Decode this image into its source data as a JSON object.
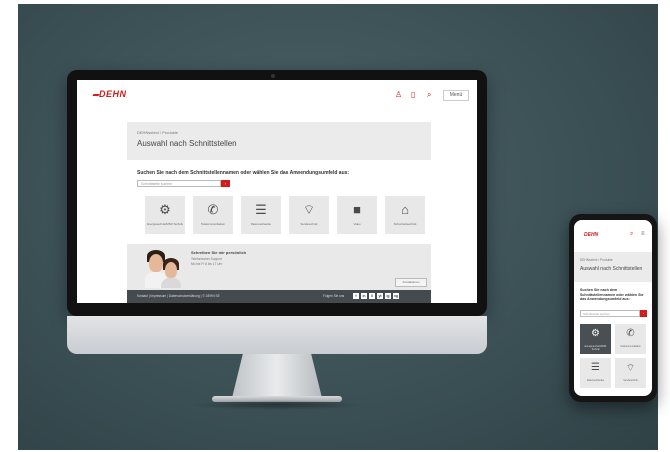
{
  "site": {
    "logo": "DEHN",
    "menu_label": "Menü",
    "breadcrumb": "DEHNselect / Produkte",
    "title": "Auswahl nach Schnittstellen",
    "heading": "Suchen Sie nach dem Schnittstellennamen oder wählen Sie das Anwendungsumfeld aus:",
    "search_placeholder": "Schnittstelle suchen",
    "search_button": "›",
    "tiles": [
      {
        "icon": "gears-icon",
        "glyph": "⚙",
        "label": "Energietechnik/MSR Technik"
      },
      {
        "icon": "phone-icon",
        "glyph": "✆",
        "label": "Telekommunikation"
      },
      {
        "icon": "server-icon",
        "glyph": "☰",
        "label": "Datennetzwerke"
      },
      {
        "icon": "wifi-icon",
        "glyph": "⌔",
        "label": "Sendetechnik"
      },
      {
        "icon": "camera-icon",
        "glyph": "■",
        "label": "Video"
      },
      {
        "icon": "house-icon",
        "glyph": "⌂",
        "label": "Sicherheitstechnik"
      }
    ],
    "contact": {
      "title": "Schreiben Sie mir persönlich",
      "line1": "Telefonischer Support",
      "line2": "Mo bis Fr 8 bis 17 Uhr",
      "button": "Kontaktieren"
    },
    "footer": {
      "left": "Kontakt | Impressum | Datenschutzerklärung | © DEHN SE",
      "right": "Folgen Sie uns",
      "social": [
        "f",
        "in",
        "X",
        "yt",
        "ig",
        "xg"
      ]
    }
  },
  "mobile": {
    "logo": "DEHN",
    "breadcrumb": "DEHNselect / Produkte",
    "title": "Auswahl nach Schnittstellen",
    "heading": "Suchen Sie nach dem Schnittstellennamen oder wählen Sie das Anwendungsumfeld aus:",
    "search_placeholder": "Schnittstelle suchen",
    "tiles": [
      {
        "glyph": "⚙",
        "label": "Energietechnik/MSR Technik"
      },
      {
        "glyph": "✆",
        "label": "Telekommunikation"
      },
      {
        "glyph": "☰",
        "label": "Datennetzwerke"
      },
      {
        "glyph": "⌔",
        "label": "Sendetechnik"
      }
    ]
  },
  "colors": {
    "brand_red": "#d21b1b",
    "footer_gray": "#454a4e",
    "backdrop": "#3c5156"
  }
}
